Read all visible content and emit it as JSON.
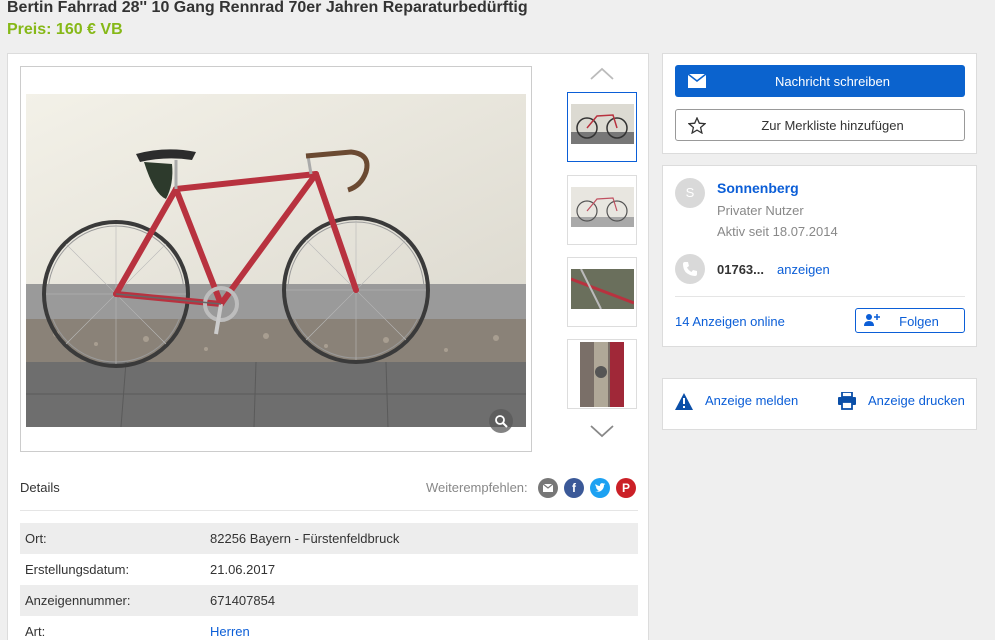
{
  "listing": {
    "title": "Bertin Fahrrad 28'' 10 Gang Rennrad 70er Jahren Reparaturbedürftig",
    "price": "Preis: 160 € VB"
  },
  "gallery": {
    "thumbnail_count": 4,
    "active_thumbnail": 1
  },
  "details": {
    "label": "Details",
    "share_label": "Weiterempfehlen:",
    "share_icons": [
      "email-icon",
      "facebook-icon",
      "twitter-icon",
      "pinterest-icon"
    ],
    "rows": [
      {
        "key": "Ort:",
        "value": "82256 Bayern - Fürstenfeldbruck"
      },
      {
        "key": "Erstellungsdatum:",
        "value": "21.06.2017"
      },
      {
        "key": "Anzeigennummer:",
        "value": "671407854"
      },
      {
        "key": "Art:",
        "value": "Herren"
      }
    ]
  },
  "contact": {
    "message_button": "Nachricht schreiben",
    "watchlist_button": "Zur Merkliste hinzufügen"
  },
  "seller": {
    "avatar_letter": "S",
    "name": "Sonnenberg",
    "type": "Privater Nutzer",
    "active_since": "Aktiv seit 18.07.2014",
    "phone": "01763...",
    "phone_show": "anzeigen",
    "ads_online": "14 Anzeigen online",
    "follow_button": "Folgen"
  },
  "actions": {
    "report": "Anzeige melden",
    "print": "Anzeige drucken"
  },
  "colors": {
    "accent_blue": "#0b63ce",
    "price_green": "#86b817",
    "facebook": "#3b5998",
    "twitter": "#1da1f2",
    "pinterest": "#cb2027",
    "email": "#777777"
  }
}
